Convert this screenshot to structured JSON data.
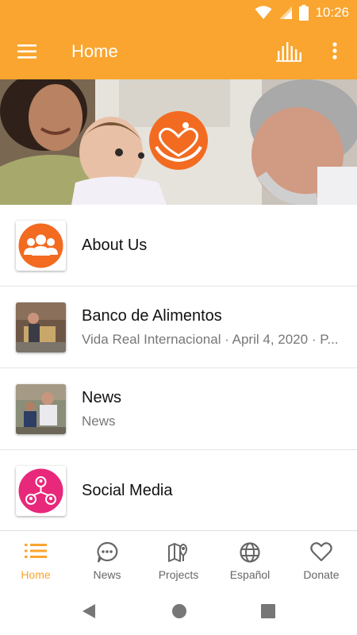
{
  "status_bar": {
    "time": "10:26"
  },
  "app_bar": {
    "title": "Home"
  },
  "list": [
    {
      "title": "About Us",
      "subtitle": ""
    },
    {
      "title": "Banco de Alimentos",
      "subtitle": "Vida Real Internacional · April 4, 2020 · P..."
    },
    {
      "title": "News",
      "subtitle": "News"
    },
    {
      "title": "Social Media",
      "subtitle": ""
    }
  ],
  "bottom_nav": [
    {
      "label": "Home",
      "icon": "list-icon",
      "active": true
    },
    {
      "label": "News",
      "icon": "chat-bubble-icon"
    },
    {
      "label": "Projects",
      "icon": "map-pin-icon"
    },
    {
      "label": "Español",
      "icon": "globe-icon"
    },
    {
      "label": "Donate",
      "icon": "heart-icon"
    }
  ],
  "colors": {
    "accent": "#f9a52f",
    "logo_orange": "#f26b21",
    "social_pink": "#e8287a"
  }
}
